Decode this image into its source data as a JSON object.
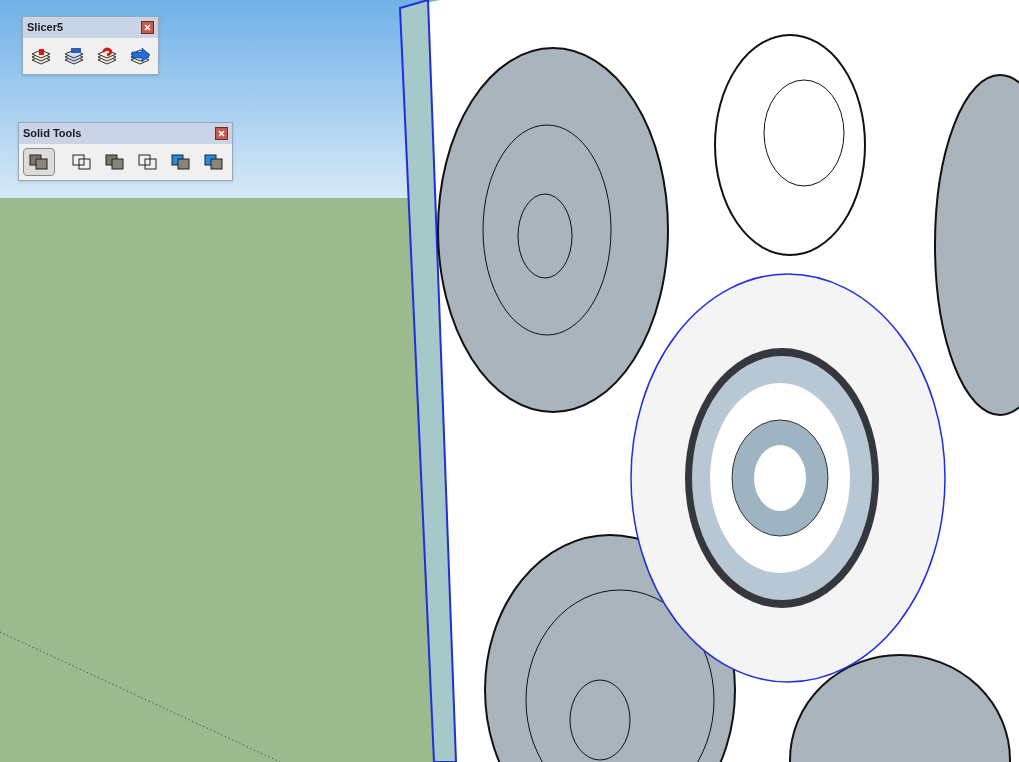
{
  "toolbars": [
    {
      "title": "Slicer5",
      "buttons": [
        {
          "kind": "stack-red",
          "selected": false
        },
        {
          "kind": "stack-blue",
          "selected": false
        },
        {
          "kind": "stack-question",
          "selected": false
        },
        {
          "kind": "stack-arrow",
          "selected": false
        }
      ]
    },
    {
      "title": "Solid Tools",
      "buttons": [
        {
          "kind": "solid",
          "selected": true
        },
        {
          "kind": "wire",
          "selected": false
        },
        {
          "kind": "solid",
          "selected": false
        },
        {
          "kind": "wire",
          "selected": false
        },
        {
          "kind": "blue",
          "selected": false
        },
        {
          "kind": "blue",
          "selected": false
        }
      ]
    }
  ]
}
